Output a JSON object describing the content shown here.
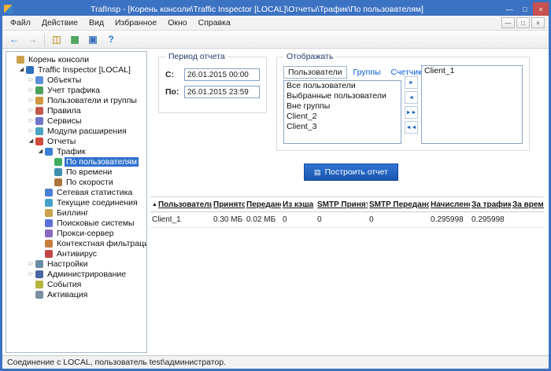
{
  "window": {
    "title": "TrafInsp - [Корень консоли\\Traffic Inspector [LOCAL]\\Отчеты\\Трафик\\По пользователям]",
    "controls": {
      "minimize": "—",
      "maximize": "□",
      "close": "×"
    }
  },
  "menu": {
    "items": [
      {
        "id": "file",
        "label": "Файл"
      },
      {
        "id": "action",
        "label": "Действие"
      },
      {
        "id": "view",
        "label": "Вид"
      },
      {
        "id": "favorites",
        "label": "Избранное"
      },
      {
        "id": "window",
        "label": "Окно"
      },
      {
        "id": "help",
        "label": "Справка"
      }
    ],
    "mdi_controls": {
      "minimize": "—",
      "restore": "□",
      "close": "×"
    }
  },
  "toolbar": {
    "buttons": [
      {
        "id": "back",
        "icon": "back-arrow-icon",
        "glyph": "←",
        "color": "#2d7dd2"
      },
      {
        "id": "forward",
        "icon": "forward-arrow-icon",
        "glyph": "→",
        "color": "#9aa7b4"
      },
      {
        "id": "sep1",
        "separator": true
      },
      {
        "id": "show-tree",
        "icon": "show-console-tree-icon",
        "glyph": "◫",
        "color": "#c89a3f"
      },
      {
        "id": "export-list",
        "icon": "export-list-icon",
        "glyph": "▦",
        "color": "#3f9b52"
      },
      {
        "id": "window",
        "icon": "window-icon",
        "glyph": "▣",
        "color": "#3b6fbf"
      },
      {
        "id": "help",
        "icon": "help-icon",
        "glyph": "?",
        "color": "#2d7dd2"
      }
    ]
  },
  "tree": {
    "items": [
      {
        "id": "console-root",
        "label": "Корень консоли",
        "level": 0,
        "expander": "none",
        "icon": "console-root-folder-icon",
        "color": "#caa24a",
        "selected": false
      },
      {
        "id": "traffic-inspector-local",
        "label": "Traffic Inspector [LOCAL]",
        "level": 1,
        "expander": "expanded",
        "icon": "traffic-inspector-icon",
        "color": "#2f6fc1",
        "selected": false
      },
      {
        "id": "objects",
        "label": "Объекты",
        "level": 2,
        "expander": "collapsed",
        "icon": "objects-icon",
        "color": "#5b8dd9",
        "selected": false
      },
      {
        "id": "traffic-accounting",
        "label": "Учет трафика",
        "level": 2,
        "expander": "collapsed",
        "icon": "traffic-accounting-icon",
        "color": "#4ba05e",
        "selected": false
      },
      {
        "id": "users-groups",
        "label": "Пользователи и группы",
        "level": 2,
        "expander": "collapsed",
        "icon": "users-groups-icon",
        "color": "#d2953f",
        "selected": false
      },
      {
        "id": "rules",
        "label": "Правила",
        "level": 2,
        "expander": "collapsed",
        "icon": "rules-icon",
        "color": "#c4574b",
        "selected": false
      },
      {
        "id": "services",
        "label": "Сервисы",
        "level": 2,
        "expander": "collapsed",
        "icon": "services-icon",
        "color": "#6f74c9",
        "selected": false
      },
      {
        "id": "extension-modules",
        "label": "Модули расширения",
        "level": 2,
        "expander": "collapsed",
        "icon": "extension-modules-icon",
        "color": "#4aa4bf",
        "selected": false
      },
      {
        "id": "reports",
        "label": "Отчеты",
        "level": 2,
        "expander": "expanded",
        "icon": "reports-icon",
        "color": "#d04a3a",
        "selected": false
      },
      {
        "id": "traffic",
        "label": "Трафик",
        "level": 3,
        "expander": "expanded",
        "icon": "traffic-chart-icon",
        "color": "#3b7fd4",
        "selected": false
      },
      {
        "id": "by-users",
        "label": "По пользователям",
        "level": 4,
        "expander": "none",
        "icon": "report-by-users-icon",
        "color": "#3fae62",
        "selected": true
      },
      {
        "id": "by-time",
        "label": "По времени",
        "level": 4,
        "expander": "none",
        "icon": "report-by-time-icon",
        "color": "#3f8fae",
        "selected": false
      },
      {
        "id": "by-speed",
        "label": "По скорости",
        "level": 4,
        "expander": "none",
        "icon": "report-by-speed-icon",
        "color": "#ae763f",
        "selected": false
      },
      {
        "id": "network-statistics",
        "label": "Сетевая статистика",
        "level": 3,
        "expander": "none",
        "icon": "network-statistics-icon",
        "color": "#4a7fd4",
        "selected": false
      },
      {
        "id": "current-connections",
        "label": "Текущие соединения",
        "level": 3,
        "expander": "none",
        "icon": "current-connections-icon",
        "color": "#44a0c8",
        "selected": false
      },
      {
        "id": "billing",
        "label": "Биллинг",
        "level": 3,
        "expander": "none",
        "icon": "billing-icon",
        "color": "#caa24a",
        "selected": false
      },
      {
        "id": "search-engines",
        "label": "Поисковые системы",
        "level": 3,
        "expander": "none",
        "icon": "search-engines-icon",
        "color": "#5b6fd9",
        "selected": false
      },
      {
        "id": "proxy-server",
        "label": "Прокси-сервер",
        "level": 3,
        "expander": "none",
        "icon": "proxy-server-icon",
        "color": "#8a68c0",
        "selected": false
      },
      {
        "id": "content-filtering",
        "label": "Контекстная фильтрация",
        "level": 3,
        "expander": "none",
        "icon": "content-filtering-icon",
        "color": "#c77f3e",
        "selected": false
      },
      {
        "id": "antivirus",
        "label": "Антивирус",
        "level": 3,
        "expander": "none",
        "icon": "antivirus-icon",
        "color": "#c4474b",
        "selected": false
      },
      {
        "id": "settings",
        "label": "Настройки",
        "level": 2,
        "expander": "collapsed",
        "icon": "settings-icon",
        "color": "#6b8ba4",
        "selected": false
      },
      {
        "id": "administration",
        "label": "Администрирование",
        "level": 2,
        "expander": "collapsed",
        "icon": "administration-icon",
        "color": "#4a66a0",
        "selected": false
      },
      {
        "id": "events",
        "label": "События",
        "level": 2,
        "expander": "none",
        "icon": "events-icon",
        "color": "#b8b23e",
        "selected": false
      },
      {
        "id": "activation",
        "label": "Активация",
        "level": 2,
        "expander": "none",
        "icon": "activation-icon",
        "color": "#7b8f9e",
        "selected": false
      }
    ]
  },
  "period": {
    "title": "Период отчета",
    "from_label": "С:",
    "from_value": "26.01.2015 00:00",
    "to_label": "По:",
    "to_value": "26.01.2015 23:59"
  },
  "display": {
    "title": "Отображать",
    "tabs": [
      {
        "id": "users",
        "label": "Пользователи",
        "active": true
      },
      {
        "id": "groups",
        "label": "Группы",
        "active": false
      },
      {
        "id": "counters",
        "label": "Счетчики",
        "active": false
      }
    ],
    "available_items": [
      "Все пользователи",
      "Выбранные пользователи",
      "Вне группы",
      "Client_2",
      "Client_3"
    ],
    "selected_items": [
      "Client_1"
    ],
    "transfer_buttons": [
      {
        "id": "add",
        "name": "move-right-button",
        "glyph": "►"
      },
      {
        "id": "remove",
        "name": "move-left-button",
        "glyph": "◄"
      },
      {
        "id": "add-all",
        "name": "move-all-right-button",
        "glyph": "►►"
      },
      {
        "id": "remove-all",
        "name": "move-all-left-button",
        "glyph": "◄◄"
      }
    ]
  },
  "report_button": {
    "label": "Построить отчет",
    "icon_glyph": "▤"
  },
  "table": {
    "columns": [
      "Пользователь",
      "Принято",
      "Передано",
      "Из кэша",
      "SMTP Принято",
      "SMTP Передано",
      "Начислено",
      "За трафик",
      "За время"
    ],
    "sort_column_index": 0,
    "sort_indicator": "▲",
    "rows": [
      [
        "Client_1",
        "0.30 МБ",
        "0.02 МБ",
        "0",
        "0",
        "0",
        "0.295998",
        "0.295998",
        ""
      ]
    ]
  },
  "statusbar": {
    "text": "Соединение с LOCAL, пользователь test\\администратор."
  }
}
